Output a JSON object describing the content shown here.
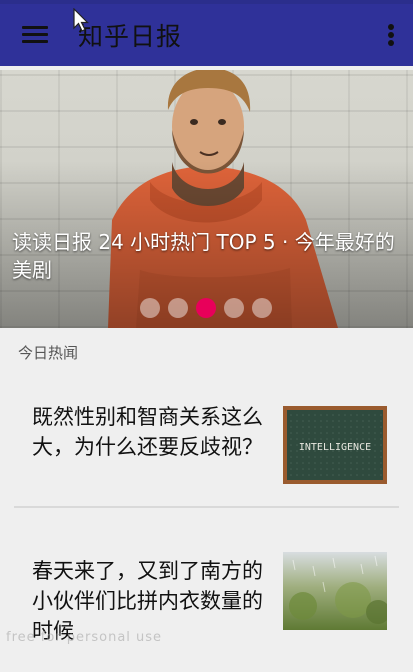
{
  "app": {
    "title": "知乎日报"
  },
  "icons": {
    "menu": "hamburger-menu-icon",
    "overflow": "overflow-menu-icon",
    "cursor": "mouse-pointer-icon"
  },
  "colors": {
    "app_bar": "#2f3199",
    "indicator_active": "#e8005a",
    "indicator_inactive": "#ffffff73",
    "background": "#efefef"
  },
  "banner": {
    "caption": "读读日报 24 小时热门 TOP 5 · 今年最好的美剧",
    "slide_count": 5,
    "active_slide": 3
  },
  "section": {
    "title": "今日热闻"
  },
  "stories": [
    {
      "title": "既然性别和智商关系这么大，为什么还要反歧视？",
      "thumb_text": "INTELLIGENCE"
    },
    {
      "title": "春天来了，又到了南方的小伙伴们比拼内衣数量的时候",
      "thumb_text": ""
    }
  ],
  "watermark": "free for personal use"
}
